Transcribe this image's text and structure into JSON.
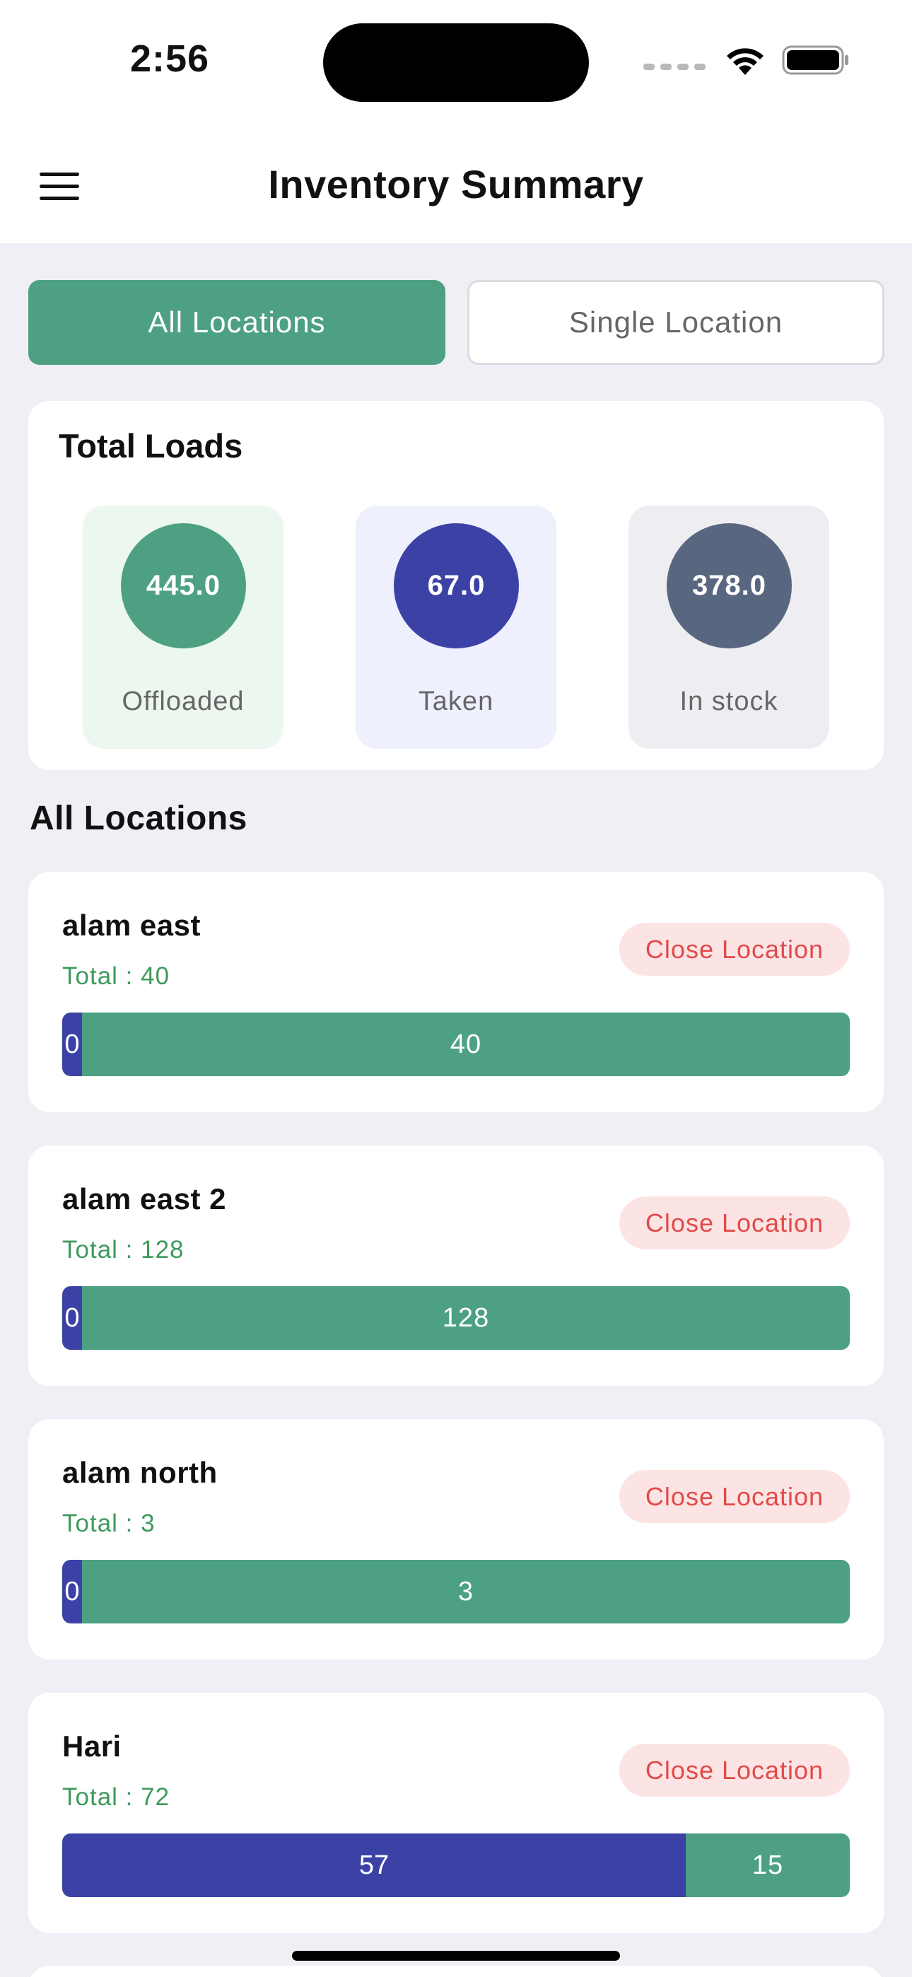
{
  "status_bar": {
    "time": "2:56"
  },
  "header": {
    "title": "Inventory Summary"
  },
  "tabs": [
    {
      "label": "All Locations",
      "active": true
    },
    {
      "label": "Single Location",
      "active": false
    }
  ],
  "total_loads": {
    "title": "Total Loads",
    "stats": [
      {
        "value": "445.0",
        "label": "Offloaded",
        "circle_color": "#4da182",
        "bg_color": "#ecf7ef"
      },
      {
        "value": "67.0",
        "label": "Taken",
        "circle_color": "#3c42a5",
        "bg_color": "#eff0fd"
      },
      {
        "value": "378.0",
        "label": "In stock",
        "circle_color": "#58677f",
        "bg_color": "#eeeef2"
      }
    ]
  },
  "section_title": "All Locations",
  "locations": [
    {
      "name": "alam east",
      "total": "Total : 40",
      "close_label": "Close Location",
      "taken": 0,
      "in_stock": 40,
      "taken_label": "0",
      "in_stock_label": "40"
    },
    {
      "name": "alam east 2",
      "total": "Total : 128",
      "close_label": "Close Location",
      "taken": 0,
      "in_stock": 128,
      "taken_label": "0",
      "in_stock_label": "128"
    },
    {
      "name": "alam north",
      "total": "Total : 3",
      "close_label": "Close Location",
      "taken": 0,
      "in_stock": 3,
      "taken_label": "0",
      "in_stock_label": "3"
    },
    {
      "name": "Hari",
      "total": "Total : 72",
      "close_label": "Close Location",
      "taken": 57,
      "in_stock": 15,
      "taken_label": "57",
      "in_stock_label": "15"
    }
  ],
  "colors": {
    "accent": "#4da182",
    "taken": "#3c42a5",
    "danger": "#e24a4a"
  }
}
